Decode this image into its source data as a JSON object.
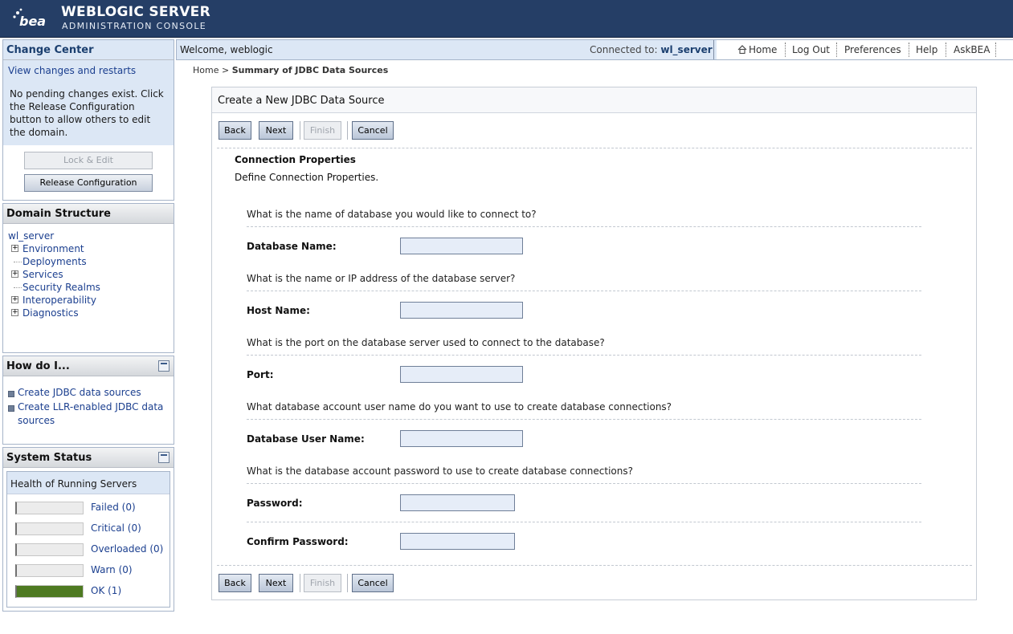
{
  "header": {
    "logo_text": "bea",
    "product_title": "WEBLOGIC SERVER",
    "product_subtitle": "ADMINISTRATION CONSOLE"
  },
  "change_center": {
    "title": "Change Center",
    "view_changes_link": "View changes and restarts",
    "message": "No pending changes exist. Click the Release Configuration button to allow others to edit the domain.",
    "lock_edit_label": "Lock & Edit",
    "release_config_label": "Release Configuration"
  },
  "domain_structure": {
    "title": "Domain Structure",
    "root": "wl_server",
    "items": [
      {
        "label": "Environment",
        "expandable": true
      },
      {
        "label": "Deployments",
        "expandable": false
      },
      {
        "label": "Services",
        "expandable": true
      },
      {
        "label": "Security Realms",
        "expandable": false
      },
      {
        "label": "Interoperability",
        "expandable": true
      },
      {
        "label": "Diagnostics",
        "expandable": true
      }
    ]
  },
  "how_do_i": {
    "title": "How do I...",
    "items": [
      {
        "label": "Create JDBC data sources"
      },
      {
        "label": "Create LLR-enabled JDBC data sources"
      }
    ]
  },
  "system_status": {
    "title": "System Status",
    "health_title": "Health of Running Servers",
    "rows": [
      {
        "label": "Failed (0)",
        "fill": 0
      },
      {
        "label": "Critical (0)",
        "fill": 0
      },
      {
        "label": "Overloaded (0)",
        "fill": 0
      },
      {
        "label": "Warn (0)",
        "fill": 0
      },
      {
        "label": "OK (1)",
        "fill": 1
      }
    ],
    "ok_color": "#4e7a21"
  },
  "topbar": {
    "welcome": "Welcome, weblogic",
    "connected_label": "Connected to:",
    "server_name": "wl_server",
    "nav": {
      "home": "Home",
      "logout": "Log Out",
      "preferences": "Preferences",
      "help": "Help",
      "askbea": "AskBEA"
    }
  },
  "breadcrumb": {
    "home": "Home",
    "separator": ">",
    "current": "Summary of JDBC Data Sources"
  },
  "form": {
    "title": "Create a New JDBC Data Source",
    "buttons": {
      "back": "Back",
      "next": "Next",
      "finish": "Finish",
      "cancel": "Cancel"
    },
    "section_title": "Connection Properties",
    "section_desc": "Define Connection Properties.",
    "fields": {
      "db_name": {
        "question": "What is the name of database you would like to connect to?",
        "label": "Database Name:",
        "value": ""
      },
      "host_name": {
        "question": "What is the name or IP address of the database server?",
        "label": "Host Name:",
        "value": ""
      },
      "port": {
        "question": "What is the port on the database server used to connect to the database?",
        "label": "Port:",
        "value": ""
      },
      "db_user": {
        "question": "What database account user name do you want to use to create database connections?",
        "label": "Database User Name:",
        "value": ""
      },
      "password": {
        "question": "What is the database account password to use to create database connections?",
        "label": "Password:",
        "value": ""
      },
      "confirm_password": {
        "label": "Confirm Password:",
        "value": ""
      }
    }
  },
  "colors": {
    "header_bg": "#253e66",
    "panel_blue": "#dce7f5",
    "link": "#1b3f8f",
    "input_bg": "#e6edf8"
  }
}
